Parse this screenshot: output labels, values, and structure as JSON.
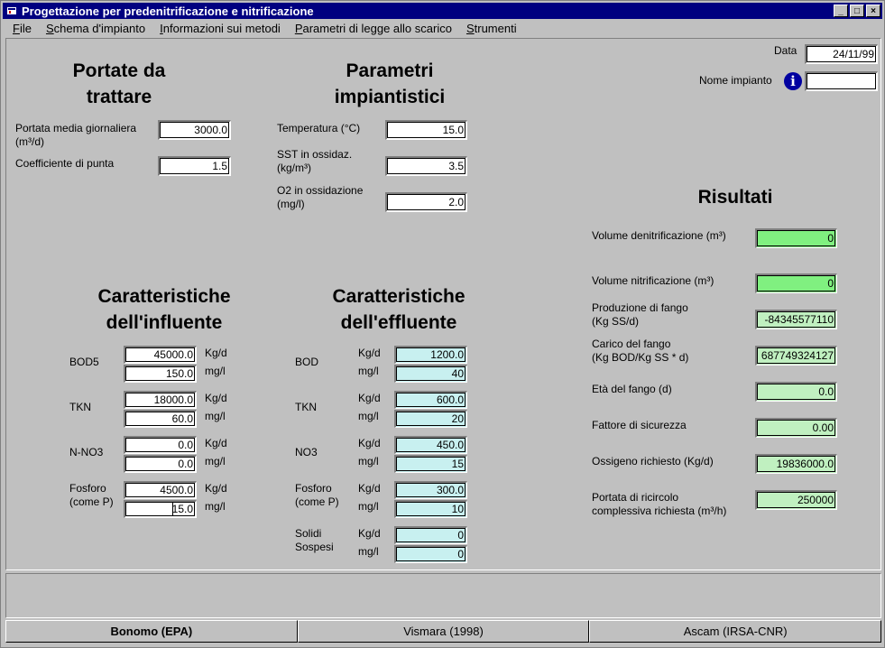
{
  "window": {
    "title": "Progettazione per predenitrificazione e nitrificazione",
    "icon": "app-icon",
    "controls": {
      "minimize": "_",
      "maximize": "□",
      "close": "×"
    }
  },
  "menu": [
    {
      "label": "File",
      "accel": "F",
      "rest": "ile"
    },
    {
      "label": "Schema d'impianto",
      "accel": "S",
      "rest": "chema d'impianto"
    },
    {
      "label": "Informazioni sui metodi",
      "accel": "I",
      "rest": "nformazioni sui metodi"
    },
    {
      "label": "Parametri di legge allo scarico",
      "accel": "P",
      "rest": "arametri di legge allo scarico"
    },
    {
      "label": "Strumenti",
      "accel": "S",
      "rest": "trumenti"
    }
  ],
  "header": {
    "date_label": "Data",
    "date_value": "24/11/99",
    "plant_label": "Nome impianto",
    "plant_value": ""
  },
  "portate": {
    "title_l1": "Portate da",
    "title_l2": "trattare",
    "portata_label_l1": "Portata media giornaliera",
    "portata_label_l2": "(m³/d)",
    "portata_value": "3000.0",
    "coeff_label": "Coefficiente di punta",
    "coeff_value": "1.5"
  },
  "parametri": {
    "title_l1": "Parametri",
    "title_l2": "impiantistici",
    "temp_label": "Temperatura (°C)",
    "temp_value": "15.0",
    "sst_label_l1": "SST in ossidaz.",
    "sst_label_l2": "(kg/m³)",
    "sst_value": "3.5",
    "o2_label_l1": "O2 in ossidazione",
    "o2_label_l2": "(mg/l)",
    "o2_value": "2.0"
  },
  "influente": {
    "title_l1": "Caratteristiche",
    "title_l2": "dell'influente",
    "unit_kg": "Kg/d",
    "unit_mg": "mg/l",
    "bod_label": "BOD5",
    "bod_kg": "45000.0",
    "bod_mg": "150.0",
    "tkn_label": "TKN",
    "tkn_kg": "18000.0",
    "tkn_mg": "60.0",
    "nno3_label": "N-NO3",
    "nno3_kg": "0.0",
    "nno3_mg": "0.0",
    "fosforo_label_l1": "Fosforo",
    "fosforo_label_l2": "(come P)",
    "fosforo_kg": "4500.0",
    "fosforo_mg": "15.0"
  },
  "effluente": {
    "title_l1": "Caratteristiche",
    "title_l2": "dell'effluente",
    "unit_kg": "Kg/d",
    "unit_mg": "mg/l",
    "bod_label": "BOD",
    "bod_kg": "1200.0",
    "bod_mg": "40",
    "tkn_label": "TKN",
    "tkn_kg": "600.0",
    "tkn_mg": "20",
    "no3_label": "NO3",
    "no3_kg": "450.0",
    "no3_mg": "15",
    "fosforo_label_l1": "Fosforo",
    "fosforo_label_l2": "(come P)",
    "fosforo_kg": "300.0",
    "fosforo_mg": "10",
    "solidi_label_l1": "Solidi",
    "solidi_label_l2": "Sospesi",
    "solidi_kg": "0",
    "solidi_mg": "0"
  },
  "risultati": {
    "title": "Risultati",
    "vol_denit_label": "Volume denitrificazione (m³)",
    "vol_denit_value": "0",
    "vol_nit_label": "Volume nitrificazione (m³)",
    "vol_nit_value": "0",
    "prod_fango_l1": "Produzione di fango",
    "prod_fango_l2": "(Kg SS/d)",
    "prod_fango_value": "-84345577110",
    "carico_l1": "Carico del fango",
    "carico_l2": "(Kg BOD/Kg SS * d)",
    "carico_value": "687749324127",
    "eta_label": "Età del fango (d)",
    "eta_value": "0.0",
    "fattore_label": "Fattore di sicurezza",
    "fattore_value": "0.00",
    "ossigeno_label": "Ossigeno richiesto (Kg/d)",
    "ossigeno_value": "19836000.0",
    "ricircolo_l1": "Portata di ricircolo",
    "ricircolo_l2": "complessiva richiesta (m³/h)",
    "ricircolo_value": "250000"
  },
  "tabs": [
    {
      "label": "Bonomo (EPA)",
      "active": true
    },
    {
      "label": "Vismara (1998)",
      "active": false
    },
    {
      "label": "Ascam (IRSA-CNR)",
      "active": false
    }
  ],
  "colors": {
    "titlebar": "#000080",
    "face": "#c0c0c0",
    "cyan_field": "#c8f0f0",
    "green_field": "#80f080",
    "info_icon": "#0000a0"
  }
}
